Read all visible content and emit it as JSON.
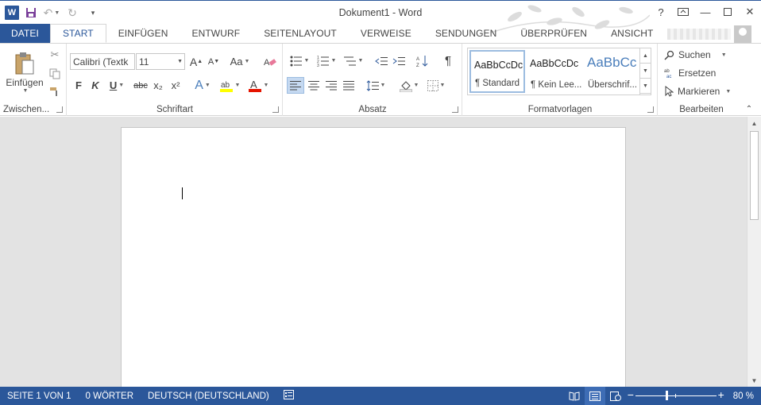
{
  "titlebar": {
    "logo": "W",
    "title": "Dokument1 - Word",
    "icons": [
      "word-logo",
      "save-icon",
      "undo-icon",
      "redo-icon",
      "customize-qat-icon"
    ],
    "help": "?"
  },
  "tabs": [
    {
      "label": "DATEI"
    },
    {
      "label": "START"
    },
    {
      "label": "EINFÜGEN"
    },
    {
      "label": "ENTWURF"
    },
    {
      "label": "SEITENLAYOUT"
    },
    {
      "label": "VERWEISE"
    },
    {
      "label": "SENDUNGEN"
    },
    {
      "label": "ÜBERPRÜFEN"
    },
    {
      "label": "ANSICHT"
    }
  ],
  "ribbon": {
    "clipboard": {
      "paste_label": "Einfügen",
      "group_label": "Zwischen..."
    },
    "font": {
      "font_name": "Calibri (Textk",
      "font_size": "11",
      "change_case": "Aa",
      "bold": "F",
      "italic": "K",
      "underline": "U",
      "strike": "abc",
      "subscript": "x₂",
      "superscript": "x²",
      "group_label": "Schriftart"
    },
    "paragraph": {
      "group_label": "Absatz",
      "pilcrow": "¶"
    },
    "styles": {
      "items": [
        {
          "sample": "AaBbCcDc",
          "label": "¶ Standard"
        },
        {
          "sample": "AaBbCcDc",
          "label": "¶ Kein Lee..."
        },
        {
          "sample": "AaBbCc",
          "label": "Überschrif..."
        }
      ],
      "group_label": "Formatvorlagen"
    },
    "editing": {
      "find": "Suchen",
      "replace": "Ersetzen",
      "select": "Markieren",
      "group_label": "Bearbeiten"
    }
  },
  "status": {
    "page": "SEITE 1 VON 1",
    "words": "0 WÖRTER",
    "language": "DEUTSCH (DEUTSCHLAND)",
    "zoom": "80 %",
    "zoom_level": 0.8,
    "active_view": "print-layout"
  },
  "colors": {
    "accent": "#2b579a",
    "highlight": "#ffff00",
    "font_color": "#e51400"
  }
}
